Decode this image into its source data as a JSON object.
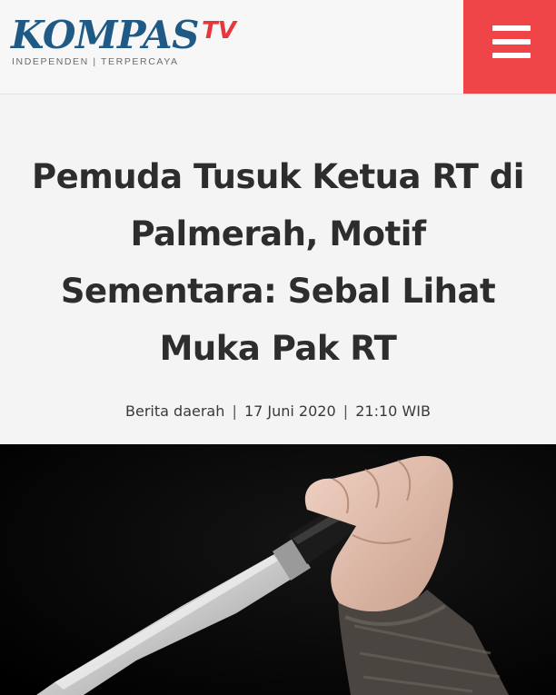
{
  "header": {
    "logo": {
      "name": "KOMPAS",
      "suffix": "TV",
      "tagline": "INDEPENDEN | TERPERCAYA"
    },
    "menu_icon": "hamburger-menu-icon"
  },
  "article": {
    "title": "Pemuda Tusuk Ketua RT di Palmerah, Motif Sementara: Sebal Lihat Muka Pak RT",
    "category": "Berita daerah",
    "date": "17 Juni 2020",
    "time": "21:10 WIB",
    "separator": "|"
  },
  "colors": {
    "brand_blue": "#1f5a86",
    "brand_red": "#e8373a",
    "menu_bg": "#ef4548"
  }
}
